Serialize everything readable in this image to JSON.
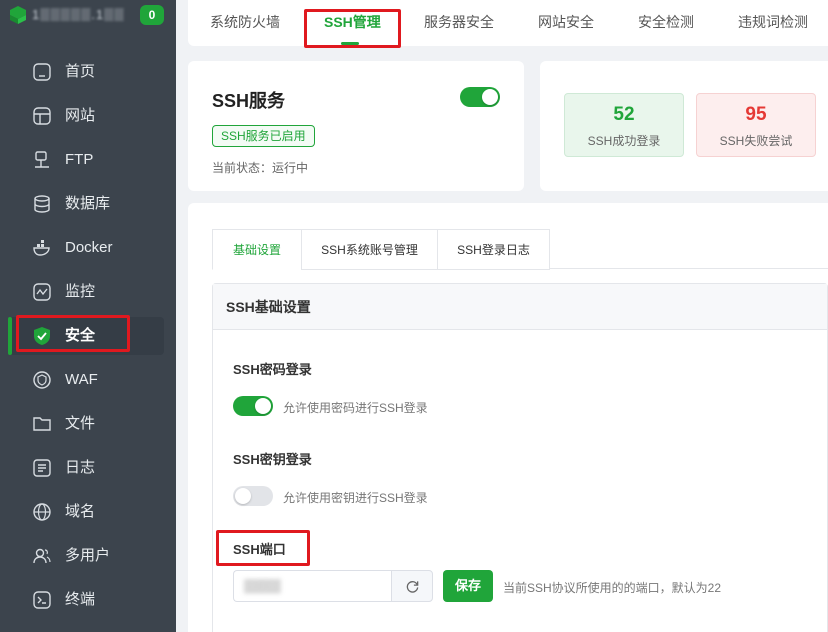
{
  "sidebar": {
    "hostname": "1▒▒▒▒▒.1▒▒",
    "badge_count": "0",
    "items": [
      {
        "label": "首页",
        "icon": "home-icon"
      },
      {
        "label": "网站",
        "icon": "globe-icon"
      },
      {
        "label": "FTP",
        "icon": "ftp-icon"
      },
      {
        "label": "数据库",
        "icon": "database-icon"
      },
      {
        "label": "Docker",
        "icon": "docker-icon"
      },
      {
        "label": "监控",
        "icon": "monitor-icon"
      },
      {
        "label": "安全",
        "icon": "shield-icon",
        "active": true
      },
      {
        "label": "WAF",
        "icon": "waf-icon"
      },
      {
        "label": "文件",
        "icon": "folder-icon"
      },
      {
        "label": "日志",
        "icon": "log-icon"
      },
      {
        "label": "域名",
        "icon": "domain-icon"
      },
      {
        "label": "多用户",
        "icon": "users-icon"
      },
      {
        "label": "终端",
        "icon": "terminal-icon"
      }
    ]
  },
  "top_tabs": [
    {
      "label": "系统防火墙"
    },
    {
      "label": "SSH管理",
      "active": true
    },
    {
      "label": "服务器安全"
    },
    {
      "label": "网站安全"
    },
    {
      "label": "安全检测"
    },
    {
      "label": "违规词检测"
    }
  ],
  "ssh_service": {
    "title": "SSH服务",
    "enabled": true,
    "status_tag": "SSH服务已启用",
    "status_line": "当前状态：运行中"
  },
  "stats": {
    "success": {
      "value": "52",
      "label": "SSH成功登录"
    },
    "failed": {
      "value": "95",
      "label": "SSH失败尝试"
    }
  },
  "sub_tabs": [
    {
      "label": "基础设置",
      "active": true
    },
    {
      "label": "SSH系统账号管理"
    },
    {
      "label": "SSH登录日志"
    }
  ],
  "settings": {
    "panel_title": "SSH基础设置",
    "password_login": {
      "label": "SSH密码登录",
      "enabled": true,
      "desc": "允许使用密码进行SSH登录"
    },
    "key_login": {
      "label": "SSH密钥登录",
      "enabled": false,
      "desc": "允许使用密钥进行SSH登录"
    },
    "port": {
      "label": "SSH端口",
      "value": "▒▒▒▒",
      "save_label": "保存",
      "desc": "当前SSH协议所使用的的端口，默认为22"
    }
  },
  "colors": {
    "accent": "#20a53a",
    "sidebar_bg": "#3c444d",
    "danger": "#e53935",
    "highlight": "#e0191f"
  }
}
